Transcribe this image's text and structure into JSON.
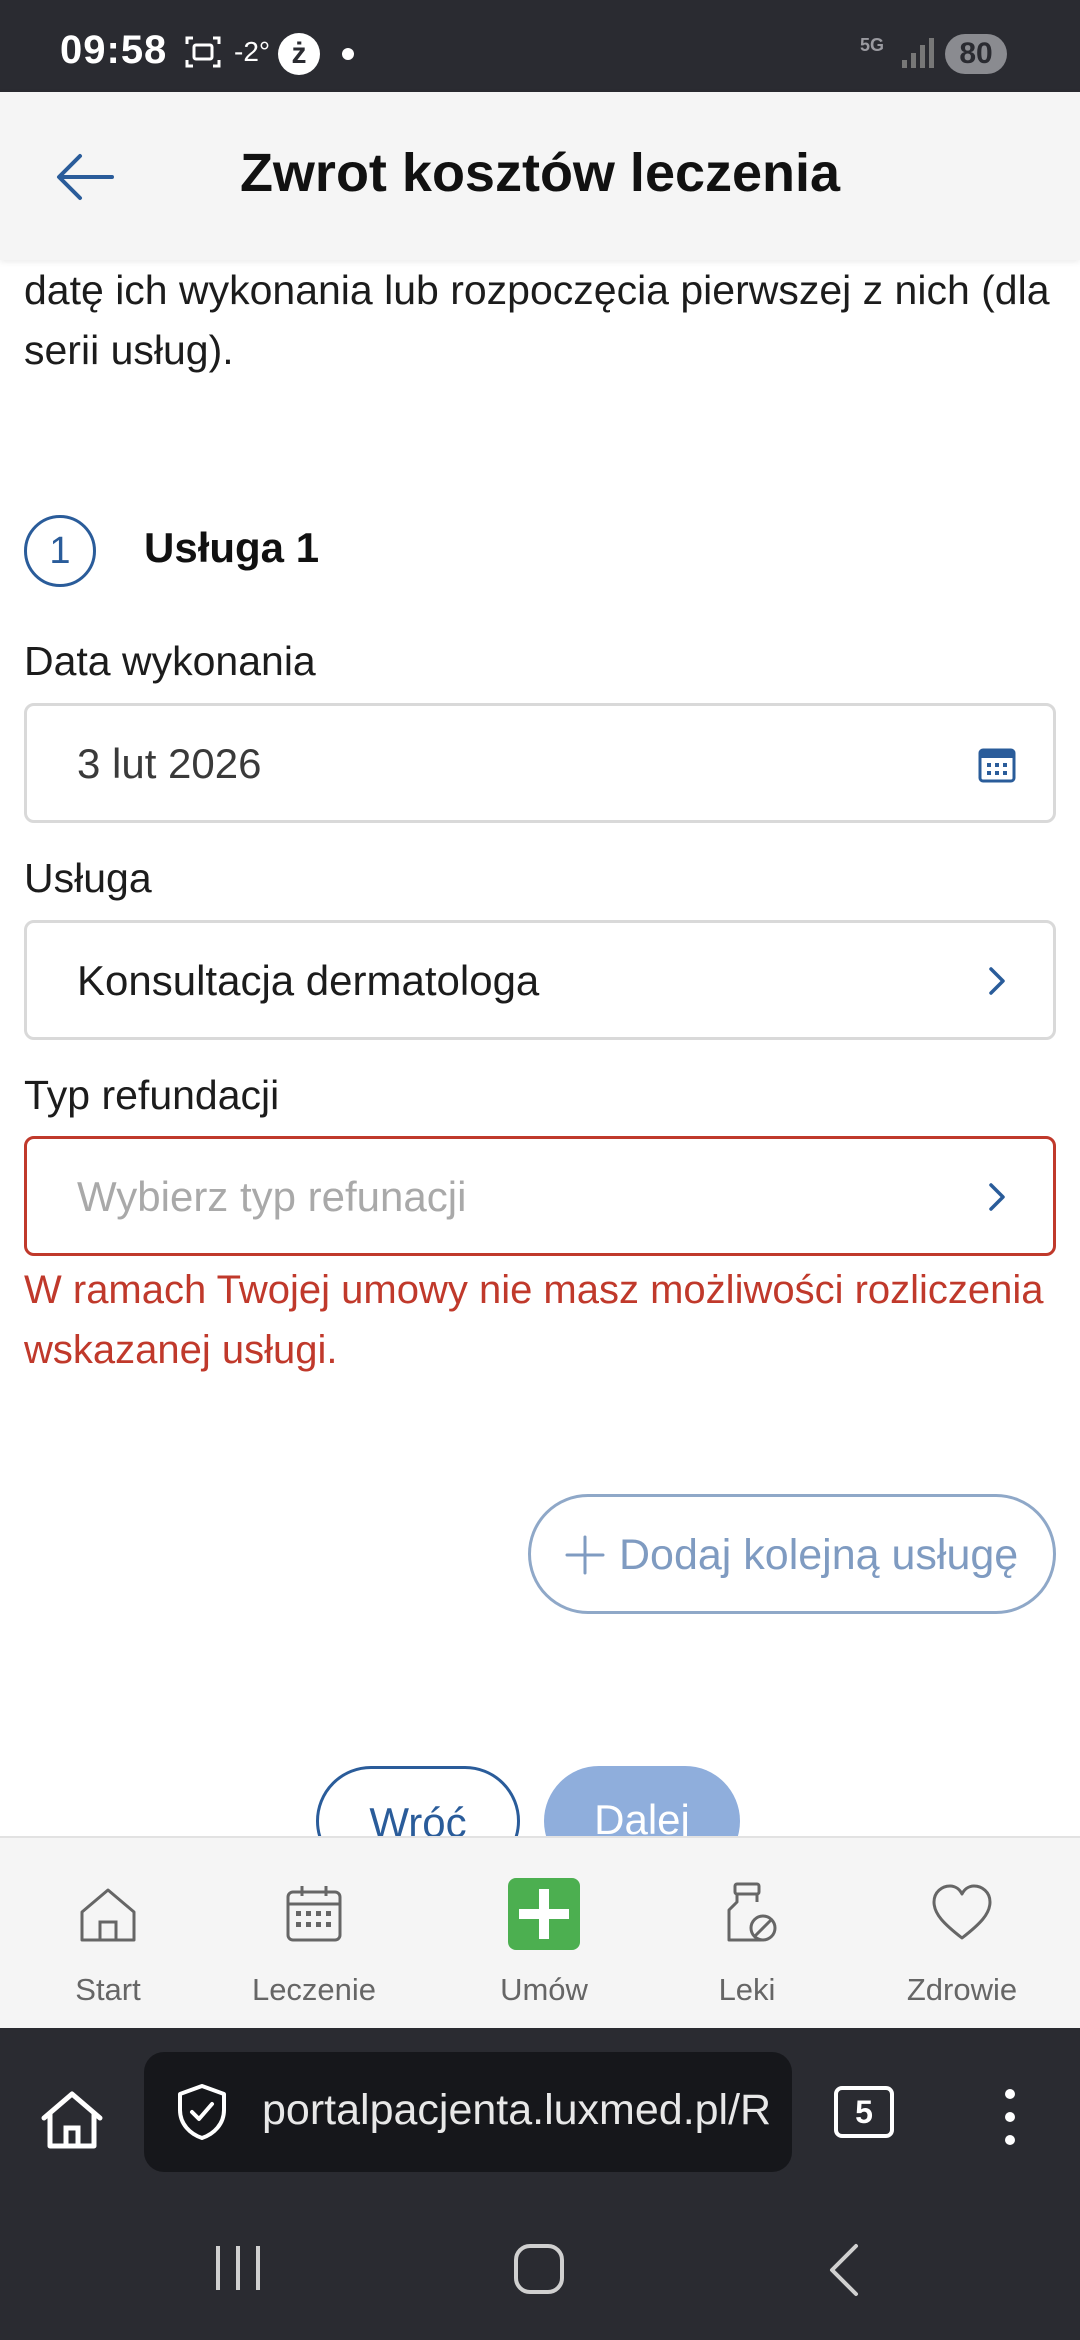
{
  "status_bar": {
    "time": "09:58",
    "temperature": "-2°",
    "notification_badge": "ż",
    "network": "5G",
    "battery": "80"
  },
  "header": {
    "title": "Zwrot kosztów leczenia"
  },
  "intro": {
    "text": "Wskaż usługi, o refundację których się ubiegasz oraz datę ich wykonania lub rozpoczęcia pierwszej z nich (dla serii usług)."
  },
  "service": {
    "step_number": "1",
    "title": "Usługa 1",
    "date_label": "Data wykonania",
    "date_value": "3 lut 2026",
    "service_label": "Usługa",
    "service_value": "Konsultacja dermatologa",
    "refund_label": "Typ refundacji",
    "refund_placeholder": "Wybierz typ refunacji",
    "error_message": "W ramach Twojej umowy nie masz możliwości rozliczenia wskazanej usługi."
  },
  "actions": {
    "add_service": "Dodaj kolejną usługę",
    "back": "Wróć",
    "next": "Dalej"
  },
  "bottom_nav": {
    "items": [
      {
        "label": "Start",
        "icon": "home-icon"
      },
      {
        "label": "Leczenie",
        "icon": "calendar-icon"
      },
      {
        "label": "Umów",
        "icon": "plus-icon"
      },
      {
        "label": "Leki",
        "icon": "medicine-icon"
      },
      {
        "label": "Zdrowie",
        "icon": "heart-icon"
      }
    ],
    "accent_color": "#4caf50"
  },
  "browser": {
    "url": "portalpacjenta.luxmed.pl/R",
    "tab_count": "5"
  },
  "colors": {
    "primary": "#2a5c9a",
    "error": "#c0392b",
    "disabled_button": "#8faedc"
  }
}
